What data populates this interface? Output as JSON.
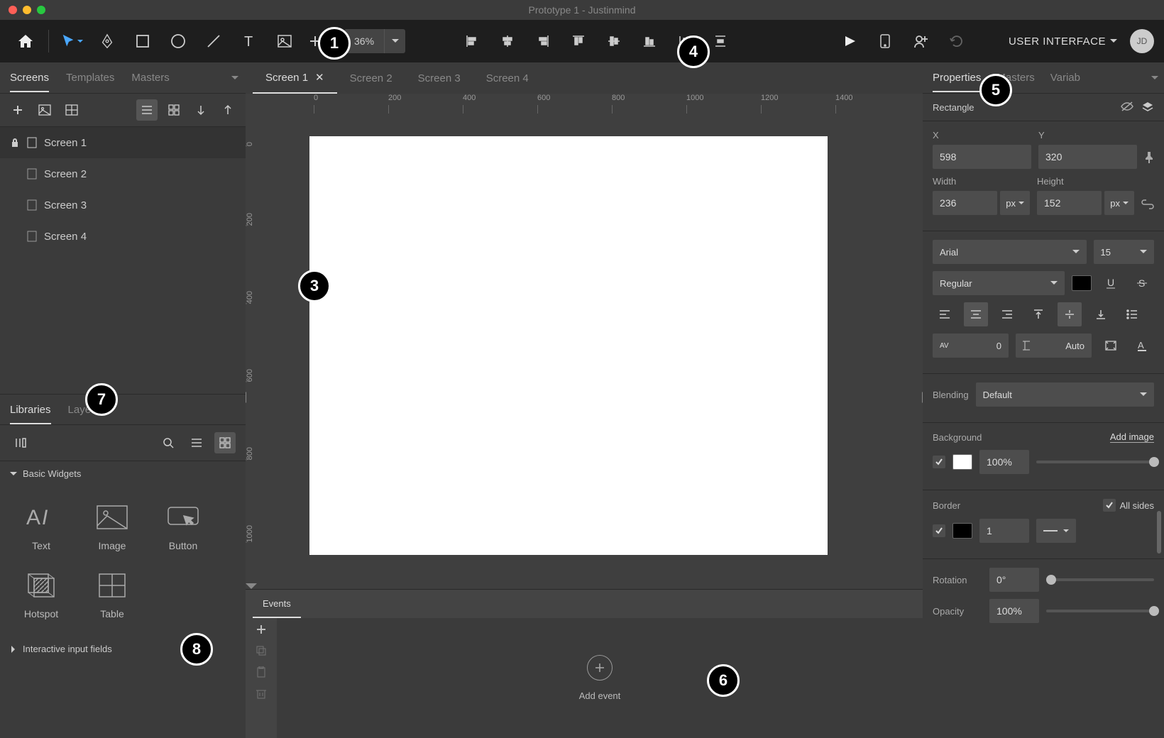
{
  "window_title": "Prototype 1 - Justinmind",
  "traffic": {
    "red": "#ff5f57",
    "yellow": "#febc2e",
    "green": "#28c840"
  },
  "toolbar": {
    "zoom": "36%",
    "ui_dropdown": "USER INTERFACE",
    "avatar": "JD"
  },
  "left_tabs": [
    "Screens",
    "Templates",
    "Masters"
  ],
  "screens": [
    {
      "name": "Screen 1",
      "active": true,
      "locked": true
    },
    {
      "name": "Screen 2"
    },
    {
      "name": "Screen 3"
    },
    {
      "name": "Screen 4"
    }
  ],
  "lib_tabs": [
    "Libraries",
    "Layers"
  ],
  "lib_section1": "Basic Widgets",
  "lib_section2": "Interactive input fields",
  "widgets": [
    {
      "label": "Text",
      "icon": "text"
    },
    {
      "label": "Image",
      "icon": "image"
    },
    {
      "label": "Button",
      "icon": "button"
    },
    {
      "label": "Hotspot",
      "icon": "hotspot"
    },
    {
      "label": "Table",
      "icon": "table"
    }
  ],
  "center_tabs": [
    {
      "label": "Screen 1",
      "active": true,
      "closeable": true
    },
    {
      "label": "Screen 2"
    },
    {
      "label": "Screen 3"
    },
    {
      "label": "Screen 4"
    }
  ],
  "ruler_h": [
    0,
    200,
    400,
    600,
    800,
    1000,
    1200,
    1400
  ],
  "ruler_v": [
    0,
    200,
    400,
    600,
    800,
    1000
  ],
  "events_tab": "Events",
  "add_event": "Add event",
  "right_tabs": [
    "Properties",
    "Masters",
    "Variab"
  ],
  "selected_element": "Rectangle",
  "props": {
    "x_label": "X",
    "x": "598",
    "y_label": "Y",
    "y": "320",
    "w_label": "Width",
    "w": "236",
    "w_unit": "px",
    "h_label": "Height",
    "h": "152",
    "h_unit": "px",
    "font": "Arial",
    "size": "15",
    "weight": "Regular",
    "spacing": "0",
    "lineheight": "Auto",
    "blend_label": "Blending",
    "blend": "Default",
    "bg_label": "Background",
    "add_image": "Add image",
    "bg_opacity": "100%",
    "border_label": "Border",
    "all_sides": "All sides",
    "border_width": "1",
    "rotation_label": "Rotation",
    "rotation": "0°",
    "opacity_label": "Opacity",
    "opacity": "100%"
  },
  "colors": {
    "text_swatch": "#000000",
    "bg_swatch": "#ffffff",
    "border_swatch": "#000000"
  }
}
